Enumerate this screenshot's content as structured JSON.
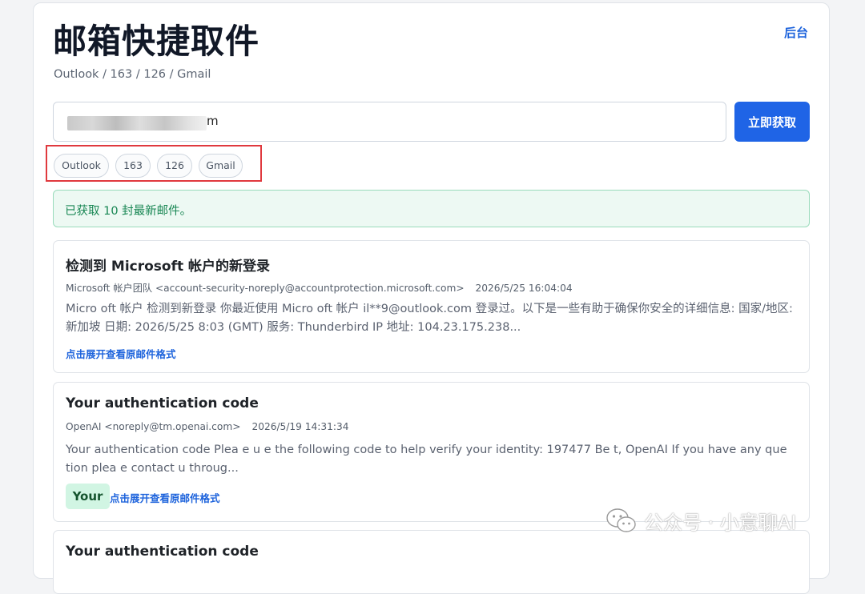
{
  "header": {
    "title": "邮箱快捷取件",
    "subtitle": "Outlook / 163 / 126 / Gmail",
    "admin_link": "后台"
  },
  "email_input": {
    "visible_tail": "m"
  },
  "fetch_button": {
    "label": "立即获取"
  },
  "providers": [
    "Outlook",
    "163",
    "126",
    "Gmail"
  ],
  "status": {
    "message": "已获取 10 封最新邮件。"
  },
  "emails": [
    {
      "subject": "检测到 Microsoft 帐户的新登录",
      "sender": "Microsoft 帐户团队 <account-security-noreply@accountprotection.microsoft.com>",
      "date": "2026/5/25 16:04:04",
      "preview": "Micro oft 帐户 检测到新登录 你最近使用 Micro oft 帐户 il**9@outlook.com 登录过。以下是一些有助于确保你安全的详细信息: 国家/地区: 新加坡 日期: 2026/5/25 8:03 (GMT) 服务: Thunderbird IP 地址: 104.23.175.238...",
      "expand_label": "点击展开查看原邮件格式"
    },
    {
      "subject": "Your authentication code",
      "sender": "OpenAI <noreply@tm.openai.com>",
      "date": "2026/5/19 14:31:34",
      "preview": "Your authentication code Plea e u e the following code to help verify your identity: 197477 Be t, OpenAI If you have any que tion plea e contact u throug...",
      "code_badge": "Your",
      "expand_label": "点击展开查看原邮件格式"
    },
    {
      "subject": "Your authentication code"
    }
  ],
  "watermark": {
    "text": "公众号 · 小意聊AI"
  }
}
